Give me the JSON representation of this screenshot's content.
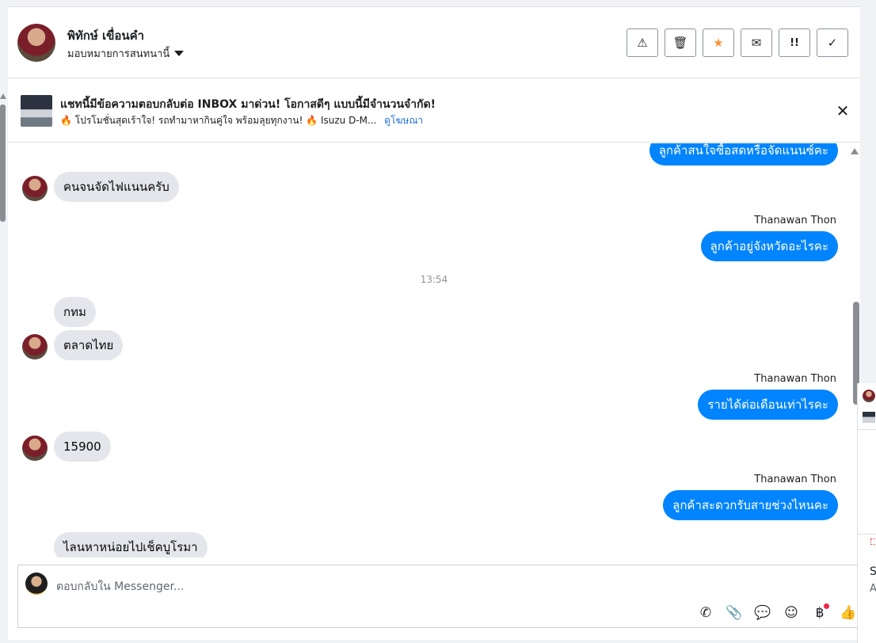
{
  "header": {
    "name": "พิทักษ์ เขื่อนคำ",
    "assign_label": "มอบหมายการสนทนานี้"
  },
  "toolbar": {
    "buttons": [
      {
        "icon": "warning-icon",
        "glyph": "⚠"
      },
      {
        "icon": "trash-icon",
        "glyph": "🗑"
      },
      {
        "icon": "star-icon",
        "glyph": "★"
      },
      {
        "icon": "mail-open-icon",
        "glyph": "✉"
      },
      {
        "icon": "important-icon",
        "glyph": "!!"
      },
      {
        "icon": "check-icon",
        "glyph": "✓"
      }
    ],
    "star_color": "#f7923b"
  },
  "promo": {
    "title": "แชทนี้มีข้อความตอบกลับต่อ INBOX มาด่วน! โอกาสดีๆ แบบนี้มีจำนวนจำกัด!",
    "subtitle": "🔥 โปรโมชั่นสุดเร้าใจ! รถทำมาหากินคู่ใจ พร้อมลุยทุกงาน! 🔥 Isuzu D-M...",
    "link": "ดูโฆษณา",
    "close": "✕"
  },
  "chat": {
    "partial_top_message": "ลูกค้าสนใจซื้อสดหรือจัดแนนซ์คะ",
    "messages": [
      {
        "dir": "in",
        "text": "คนจนจัดไฟแนนครับ"
      },
      {
        "dir": "out",
        "sender": "Thanawan Thon",
        "text": "ลูกค้าอยู่จังหวัดอะไรคะ"
      },
      {
        "dir": "time",
        "text": "13:54"
      },
      {
        "dir": "in",
        "text": "กทม"
      },
      {
        "dir": "in",
        "text": "ตลาดไทย"
      },
      {
        "dir": "out",
        "sender": "Thanawan Thon",
        "text": "รายได้ต่อเดือนเท่าไรคะ"
      },
      {
        "dir": "in",
        "text": "15900"
      },
      {
        "dir": "out",
        "sender": "Thanawan Thon",
        "text": "ลูกค้าสะดวกรับสายช่วงไหนคะ"
      },
      {
        "dir": "in",
        "text": "ไลนหาหน่อยไปเช็คบูโรมา"
      }
    ],
    "out_color": "#0084ff",
    "in_color": "#e4e6eb"
  },
  "composer": {
    "placeholder": "ตอบกลับใน Messenger...",
    "icons": [
      {
        "name": "phone-add-icon",
        "glyph": "✆"
      },
      {
        "name": "attachment-icon",
        "glyph": "📎"
      },
      {
        "name": "saved-reply-icon",
        "glyph": "💬"
      },
      {
        "name": "emoji-icon",
        "glyph": "☺"
      },
      {
        "name": "baht-payment-icon",
        "glyph": "฿"
      },
      {
        "name": "thumbs-up-icon",
        "glyph": "👍"
      }
    ]
  },
  "side": {
    "line1": "S",
    "line2": "A"
  }
}
